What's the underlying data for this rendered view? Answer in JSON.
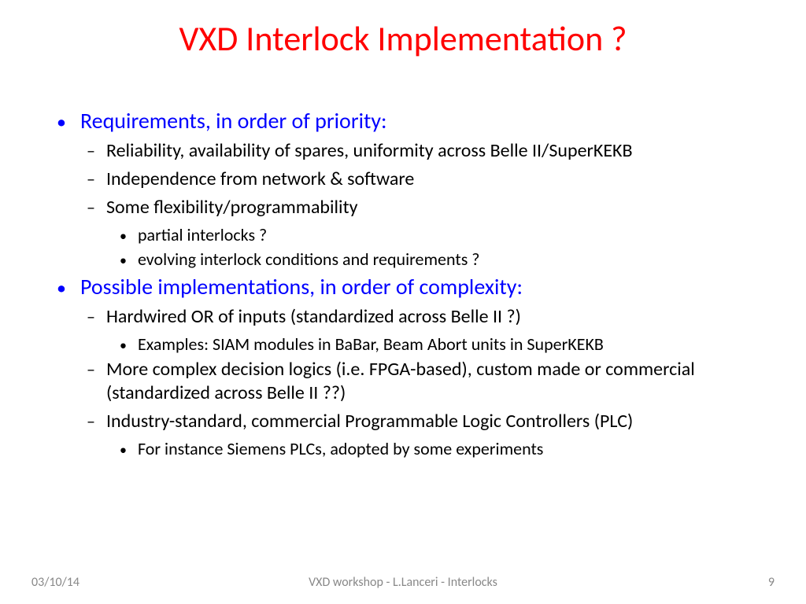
{
  "title": "VXD Interlock Implementation ?",
  "sections": [
    {
      "heading": "Requirements, in order of priority:",
      "items": [
        {
          "text": "Reliability, availability of spares, uniformity across Belle II/SuperKEKB"
        },
        {
          "text": "Independence from network & software"
        },
        {
          "text": "Some flexibility/programmability",
          "subitems": [
            "partial interlocks ?",
            "evolving interlock conditions and requirements ?"
          ]
        }
      ]
    },
    {
      "heading": "Possible implementations, in order of complexity:",
      "items": [
        {
          "text": "Hardwired OR of inputs (standardized across Belle II ?)",
          "subitems": [
            "Examples: SIAM modules in BaBar, Beam Abort units in SuperKEKB"
          ]
        },
        {
          "text": "More complex decision logics (i.e. FPGA-based), custom made or commercial (standardized across Belle II ??)"
        },
        {
          "text": "Industry-standard, commercial Programmable Logic Controllers (PLC)",
          "subitems": [
            "For instance Siemens PLCs, adopted by some experiments"
          ]
        }
      ]
    }
  ],
  "footer": {
    "date": "03/10/14",
    "center": "VXD workshop - L.Lanceri - Interlocks",
    "page": "9"
  }
}
